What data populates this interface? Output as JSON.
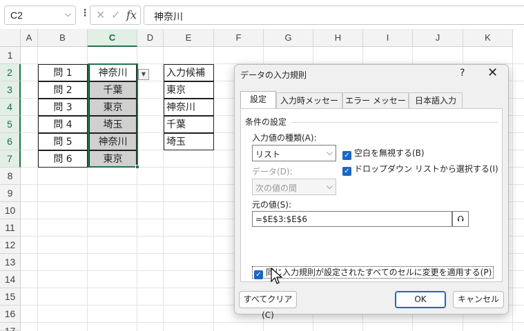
{
  "formula_bar": {
    "name_box": "C2",
    "name_box_chevron": "⌵",
    "dots": "⋮",
    "cancel_glyph": "✕",
    "enter_glyph": "✓",
    "fx_label": "fx",
    "formula": "神奈川"
  },
  "columns": [
    "A",
    "B",
    "C",
    "D",
    "E",
    "F",
    "G",
    "H",
    "I",
    "J",
    "K"
  ],
  "rows": [
    "1",
    "2",
    "3",
    "4",
    "5",
    "6",
    "7",
    "8",
    "9",
    "10",
    "11",
    "12",
    "13",
    "14",
    "15",
    "16",
    "17"
  ],
  "col_b": [
    "問 1",
    "問 2",
    "問 3",
    "問 4",
    "問 5",
    "問 6"
  ],
  "col_c": [
    "神奈川",
    "千葉",
    "東京",
    "埼玉",
    "神奈川",
    "東京"
  ],
  "col_e": [
    "入力候補",
    "東京",
    "神奈川",
    "千葉",
    "埼玉"
  ],
  "dropdown_arrow": "▼",
  "dialog": {
    "title": "データの入力規則",
    "help": "?",
    "close": "✕",
    "tabs": [
      "設定",
      "入力時メッセージ",
      "エラー メッセージ",
      "日本語入力"
    ],
    "group_label": "条件の設定",
    "allow_label": "入力値の種類(A):",
    "allow_value": "リスト",
    "data_label": "データ(D):",
    "data_value": "次の値の間",
    "chevron": "⌵",
    "ignore_blank": "空白を無視する(B)",
    "in_cell_dropdown": "ドロップダウン リストから選択する(I)",
    "check_glyph": "✓",
    "source_label": "元の値(S):",
    "source_value": "=$E$3:$E$6",
    "collapse_glyph": "⮉",
    "apply_all": "同じ入力規則が設定されたすべてのセルに変更を適用する(P)",
    "clear_all": "すべてクリア(C)",
    "ok": "OK",
    "cancel": "キャンセル"
  }
}
